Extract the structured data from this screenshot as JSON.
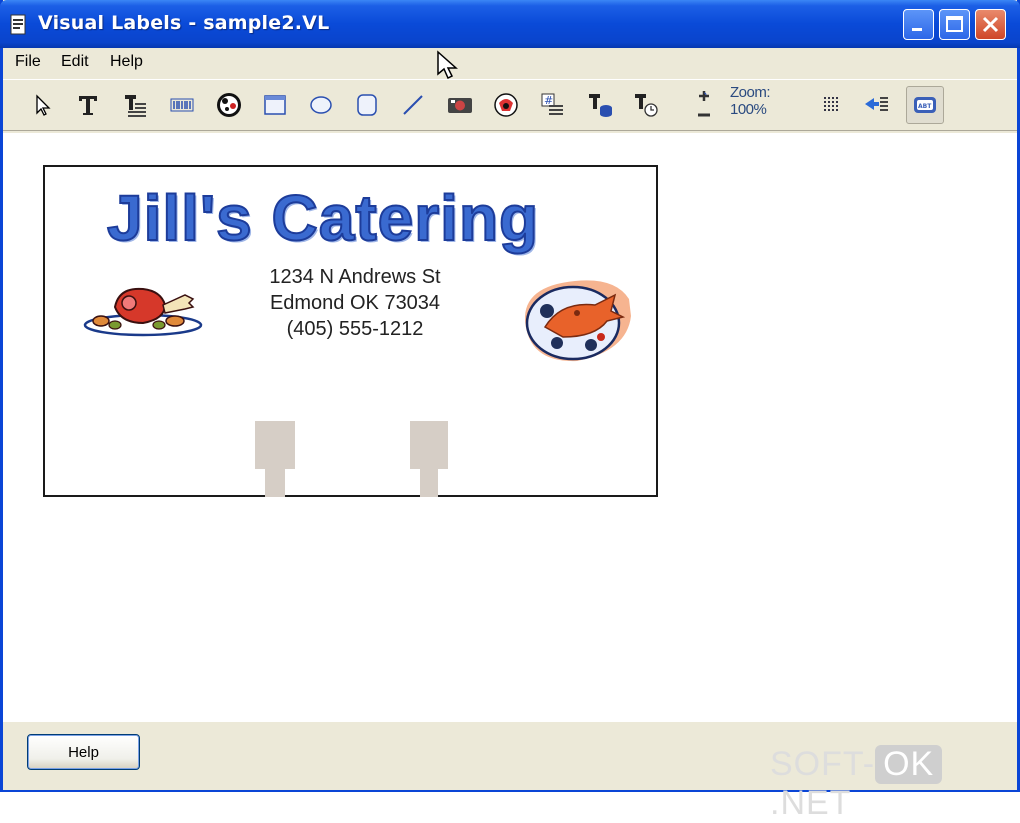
{
  "window": {
    "title": "Visual Labels - sample2.VL"
  },
  "menu": {
    "file": "File",
    "edit": "Edit",
    "help": "Help"
  },
  "toolbar": {
    "tools": [
      "select-tool",
      "text-tool",
      "paragraph-tool",
      "barcode-tool",
      "image-tool",
      "rectangle-tool",
      "ellipse-tool",
      "rounded-rect-tool",
      "line-tool",
      "picture-tool",
      "clipart-tool",
      "serial-text-tool",
      "database-text-tool",
      "date-text-tool"
    ],
    "zoom_label": "Zoom:",
    "zoom_value": "100%"
  },
  "label": {
    "title": "Jill's Catering",
    "address_line1": "1234 N Andrews St",
    "address_line2": "Edmond OK 73034",
    "phone": "(405) 555-1212"
  },
  "footer": {
    "help_label": "Help"
  },
  "watermark": {
    "left": "SOFT-",
    "mid": "OK",
    "right": ".NET"
  },
  "colors": {
    "title_blue": "#3a6ad0",
    "titlebar": "#0a4ad8",
    "close_red": "#cf4627"
  }
}
